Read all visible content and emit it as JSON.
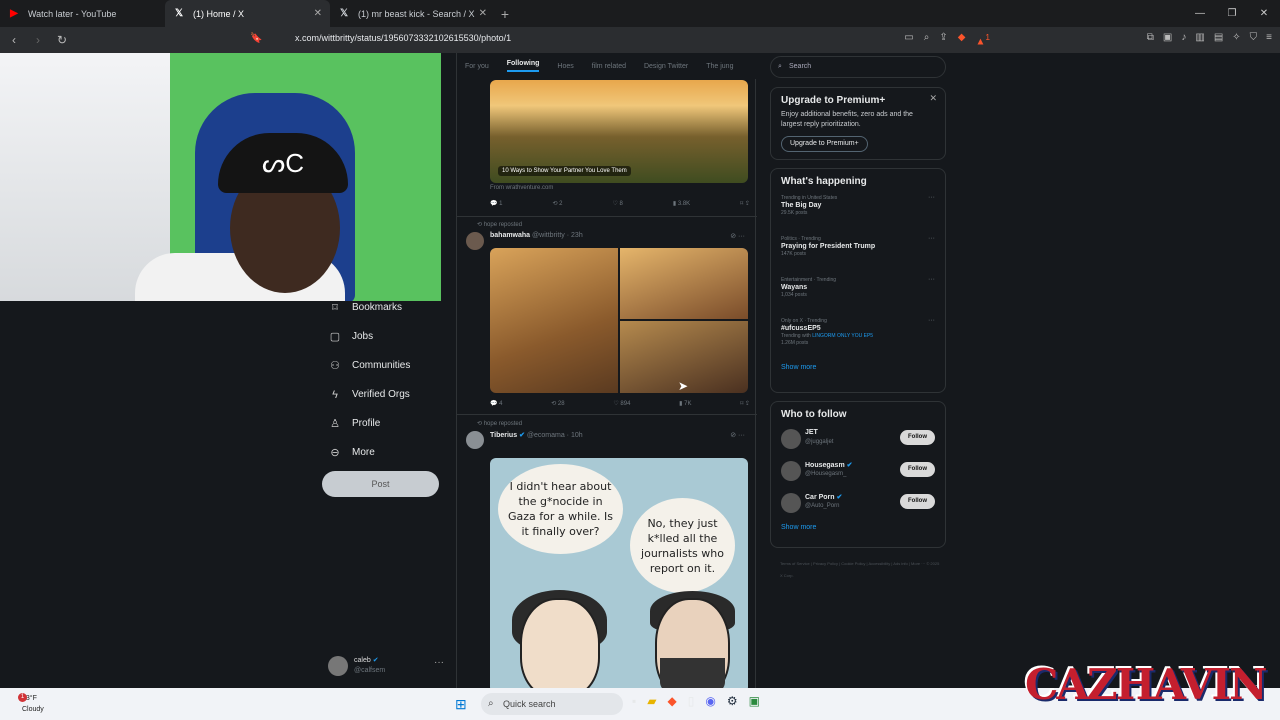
{
  "browser": {
    "tabs": [
      {
        "label": "Watch later - YouTube",
        "icon": "youtube-icon"
      },
      {
        "label": "(1) Home / X",
        "icon": "x-icon"
      },
      {
        "label": "(1) mr beast kick - Search / X",
        "icon": "x-icon"
      }
    ],
    "url": "x.com/wittbritty/status/1956073332102615530/photo/1",
    "brave_badge": "1"
  },
  "sidebar": {
    "items": [
      {
        "label": "Bookmarks",
        "icon": "bookmark-icon"
      },
      {
        "label": "Jobs",
        "icon": "briefcase-icon"
      },
      {
        "label": "Communities",
        "icon": "people-icon"
      },
      {
        "label": "Verified Orgs",
        "icon": "lightning-icon"
      },
      {
        "label": "Profile",
        "icon": "person-icon"
      },
      {
        "label": "More",
        "icon": "more-circle-icon"
      }
    ],
    "post_label": "Post",
    "account": {
      "name": "caleb",
      "handle": "@calfsem"
    }
  },
  "feed": {
    "tabs": [
      "For you",
      "Following",
      "Hoes",
      "film related",
      "Design Twitter",
      "The jung"
    ],
    "post1": {
      "image_caption": "10 Ways to Show Your Partner You Love Them",
      "from": "From wrathventure.com",
      "stats": {
        "replies": "1",
        "reposts": "2",
        "likes": "8",
        "views": "3.8K"
      }
    },
    "post2": {
      "repost_line": "hope reposted",
      "name": "bahamwaha",
      "handle": "@wittbritty · 23h",
      "stats": {
        "replies": "4",
        "reposts": "28",
        "likes": "894",
        "views": "7K"
      }
    },
    "post3": {
      "repost_line": "hope reposted",
      "name": "Tiberius",
      "handle": "@ecomama · 10h",
      "bubble_left": "I didn't hear about the g*nocide in Gaza for a while. Is it finally over?",
      "bubble_right": "No, they just k*lled all the journalists who report on it."
    }
  },
  "right": {
    "search_placeholder": "Search",
    "premium": {
      "title": "Upgrade to Premium+",
      "desc": "Enjoy additional benefits, zero ads and the largest reply prioritization.",
      "button": "Upgrade to Premium+"
    },
    "happening": {
      "title": "What's happening",
      "trends": [
        {
          "ctx": "Trending in United States",
          "name": "The Big Day",
          "sub": "29.5K posts"
        },
        {
          "ctx": "Politics · Trending",
          "name": "Praying for President Trump",
          "sub": "147K posts"
        },
        {
          "ctx": "Entertainment · Trending",
          "name": "Wayans",
          "sub": "1,034 posts"
        },
        {
          "ctx": "Only on X · Trending",
          "name": "#ufcussEP5",
          "sub_prefix": "Trending with",
          "sub_link": "LINGORM ONLY YOU EP5",
          "sub2": "1.26M posts"
        }
      ],
      "show_more": "Show more"
    },
    "who_to_follow": {
      "title": "Who to follow",
      "accounts": [
        {
          "name": "JET",
          "handle": "@juggaljet",
          "button": "Follow"
        },
        {
          "name": "Housegasm",
          "handle": "@Housegasm_",
          "button": "Follow"
        },
        {
          "name": "Car Porn",
          "handle": "@Auto_Porn",
          "button": "Follow"
        }
      ],
      "show_more": "Show more"
    },
    "footer": "Terms of Service | Privacy Policy | Cookie Policy | Accessibility | Ads info | More ··· © 2025 X Corp."
  },
  "taskbar": {
    "weather_temp": "93°F",
    "weather_desc": "Cloudy",
    "weather_badge": "1",
    "search_label": "Quick search"
  },
  "overlay": {
    "logo_text": "CAZHAVIN"
  }
}
